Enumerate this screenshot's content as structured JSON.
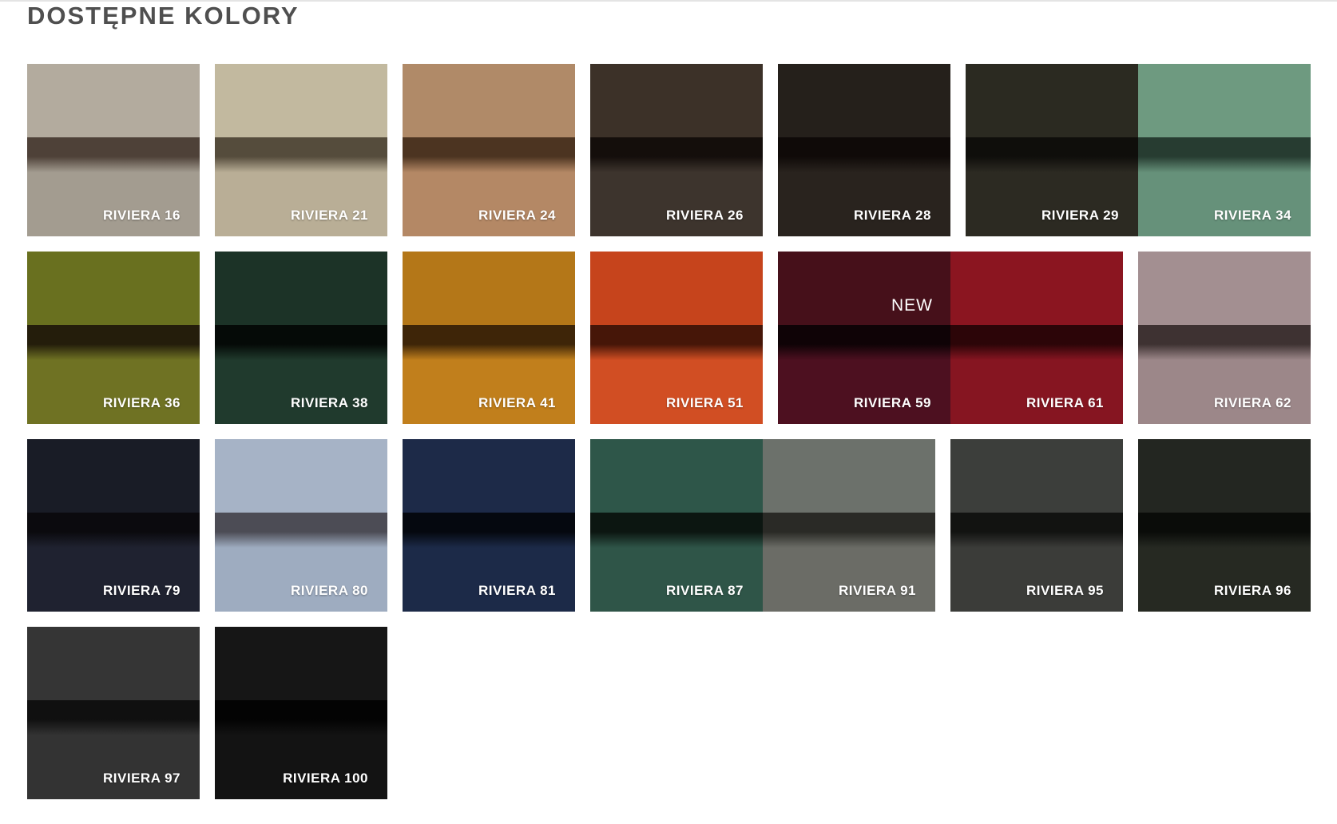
{
  "section": {
    "title": "DOSTĘPNE KOLORY"
  },
  "swatches": [
    {
      "label": "RIVIERA 16",
      "top": "#b3ab9e",
      "fold": "#4e4138",
      "bottom": "#a39c90"
    },
    {
      "label": "RIVIERA 21",
      "top": "#c2b99f",
      "fold": "#554c3c",
      "bottom": "#b9ae96"
    },
    {
      "label": "RIVIERA 24",
      "top": "#b08a68",
      "fold": "#4c3421",
      "bottom": "#b48865"
    },
    {
      "label": "RIVIERA 26",
      "top": "#3c3128",
      "fold": "#140e0b",
      "bottom": "#3d342d"
    },
    {
      "label": "RIVIERA 28",
      "top": "#25201b",
      "fold": "#0f0a08",
      "bottom": "#29231e"
    },
    {
      "label": "RIVIERA 29",
      "top": "#2b2a21",
      "fold": "#0f0e0b",
      "bottom": "#2c2a22"
    },
    {
      "label": "RIVIERA 34",
      "top": "#6e9a80",
      "fold": "#273c31",
      "bottom": "#66917a"
    },
    {
      "label": "RIVIERA 36",
      "top": "#69701f",
      "fold": "#241d0b",
      "bottom": "#6f7223"
    },
    {
      "label": "RIVIERA 38",
      "top": "#1c3327",
      "fold": "#050a07",
      "bottom": "#203a2d"
    },
    {
      "label": "RIVIERA 41",
      "top": "#b47718",
      "fold": "#3e2508",
      "bottom": "#c17f1c"
    },
    {
      "label": "RIVIERA 51",
      "top": "#c6441c",
      "fold": "#461608",
      "bottom": "#d14e23"
    },
    {
      "label": "RIVIERA 59",
      "top": "#46101a",
      "fold": "#0f0306",
      "bottom": "#4d1020",
      "new": "NEW"
    },
    {
      "label": "RIVIERA 61",
      "top": "#8b1520",
      "fold": "#2c0508",
      "bottom": "#861521"
    },
    {
      "label": "RIVIERA 62",
      "top": "#a38f91",
      "fold": "#3e3232",
      "bottom": "#9c8789"
    },
    {
      "label": "RIVIERA 79",
      "top": "#191c26",
      "fold": "#0b0a0e",
      "bottom": "#1f2230"
    },
    {
      "label": "RIVIERA 80",
      "top": "#a6b3c6",
      "fold": "#4c4c55",
      "bottom": "#9eacc0"
    },
    {
      "label": "RIVIERA 81",
      "top": "#1d2a48",
      "fold": "#05080f",
      "bottom": "#1c2a48"
    },
    {
      "label": "RIVIERA 87",
      "top": "#2e5649",
      "fold": "#0c1611",
      "bottom": "#2f5548"
    },
    {
      "label": "RIVIERA 91",
      "top": "#6c716b",
      "fold": "#2a2a26",
      "bottom": "#6b6c66"
    },
    {
      "label": "RIVIERA 95",
      "top": "#3c3e3b",
      "fold": "#121311",
      "bottom": "#3b3c39"
    },
    {
      "label": "RIVIERA 96",
      "top": "#232621",
      "fold": "#0a0c09",
      "bottom": "#262922"
    },
    {
      "label": "RIVIERA 97",
      "top": "#353535",
      "fold": "#101010",
      "bottom": "#333333"
    },
    {
      "label": "RIVIERA 100",
      "top": "#161616",
      "fold": "#030303",
      "bottom": "#131313"
    }
  ]
}
